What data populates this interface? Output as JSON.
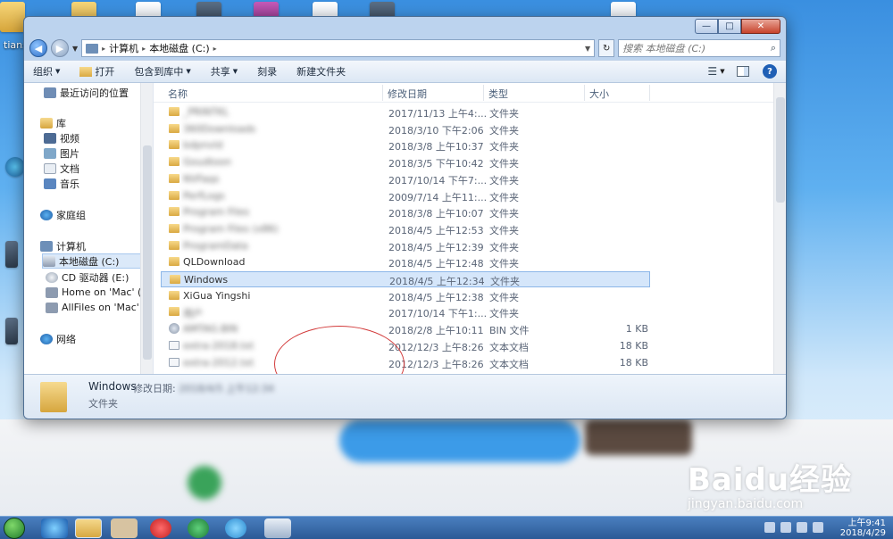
{
  "window": {
    "controls": {
      "minimize": "—",
      "maximize": "□",
      "close": "✕"
    }
  },
  "address": {
    "segments": [
      "计算机",
      "本地磁盘 (C:)"
    ],
    "search_placeholder": "搜索 本地磁盘 (C:)"
  },
  "toolbar": {
    "organize": "组织",
    "open": "打开",
    "include_in_library": "包含到库中",
    "share": "共享",
    "burn": "刻录",
    "new_folder": "新建文件夹"
  },
  "nav": {
    "recent": "最近访问的位置",
    "library": "库",
    "videos": "视频",
    "pictures": "图片",
    "documents": "文档",
    "music": "音乐",
    "homegroup": "家庭组",
    "computer": "计算机",
    "local_disk": "本地磁盘 (C:)",
    "cd_drive": "CD 驱动器 (E:)",
    "home_mac": "Home on 'Mac' (Y",
    "allfiles_mac": "AllFiles on 'Mac' (",
    "network": "网络"
  },
  "columns": {
    "name": "名称",
    "date": "修改日期",
    "type": "类型",
    "size": "大小"
  },
  "files": [
    {
      "name": "_PRINTKL",
      "date": "2017/11/13 上午4:...",
      "type": "文件夹",
      "size": "",
      "blurred": true,
      "icon": "folder"
    },
    {
      "name": "360Downloads",
      "date": "2018/3/10 下午2:06",
      "type": "文件夹",
      "size": "",
      "blurred": true,
      "icon": "folder"
    },
    {
      "name": "bdpnvld",
      "date": "2018/3/8 上午10:37",
      "type": "文件夹",
      "size": "",
      "blurred": true,
      "icon": "folder"
    },
    {
      "name": "Goudtoon",
      "date": "2018/3/5 下午10:42",
      "type": "文件夹",
      "size": "",
      "blurred": true,
      "icon": "folder"
    },
    {
      "name": "NVFaqs",
      "date": "2017/10/14 下午7:...",
      "type": "文件夹",
      "size": "",
      "blurred": true,
      "icon": "folder"
    },
    {
      "name": "PerfLogs",
      "date": "2009/7/14 上午11:...",
      "type": "文件夹",
      "size": "",
      "blurred": true,
      "icon": "folder"
    },
    {
      "name": "Program Files",
      "date": "2018/3/8 上午10:07",
      "type": "文件夹",
      "size": "",
      "blurred": true,
      "icon": "folder"
    },
    {
      "name": "Program Files (x86)",
      "date": "2018/4/5 上午12:53",
      "type": "文件夹",
      "size": "",
      "blurred": true,
      "icon": "folder"
    },
    {
      "name": "ProgramData",
      "date": "2018/4/5 上午12:39",
      "type": "文件夹",
      "size": "",
      "blurred": true,
      "icon": "folder"
    },
    {
      "name": "QLDownload",
      "date": "2018/4/5 上午12:48",
      "type": "文件夹",
      "size": "",
      "blurred": false,
      "icon": "folder"
    },
    {
      "name": "Windows",
      "date": "2018/4/5 上午12:34",
      "type": "文件夹",
      "size": "",
      "blurred": false,
      "icon": "folder",
      "selected": true
    },
    {
      "name": "XiGua Yingshi",
      "date": "2018/4/5 上午12:38",
      "type": "文件夹",
      "size": "",
      "blurred": false,
      "icon": "folder"
    },
    {
      "name": "用户",
      "date": "2017/10/14 下午1:...",
      "type": "文件夹",
      "size": "",
      "blurred": true,
      "icon": "folder"
    },
    {
      "name": "AMTAG.BIN",
      "date": "2018/2/8 上午10:11",
      "type": "BIN 文件",
      "size": "1 KB",
      "blurred": true,
      "icon": "bin"
    },
    {
      "name": "extra-2018.txt",
      "date": "2012/12/3 上午8:26",
      "type": "文本文档",
      "size": "18 KB",
      "blurred": true,
      "icon": "txt"
    },
    {
      "name": "extra-2012.txt",
      "date": "2012/12/3 上午8:26",
      "type": "文本文档",
      "size": "18 KB",
      "blurred": true,
      "icon": "txt"
    }
  ],
  "details": {
    "name": "Windows",
    "modified_label": "修改日期:",
    "modified_value": "2018/4/5 上午12:34",
    "type": "文件夹"
  },
  "desktop": {
    "label_tians": "tians"
  },
  "taskbar": {
    "time": "上午9:41",
    "date": "2018/4/29"
  },
  "watermark": {
    "brand": "Baidu经验",
    "url": "jingyan.baidu.com"
  }
}
